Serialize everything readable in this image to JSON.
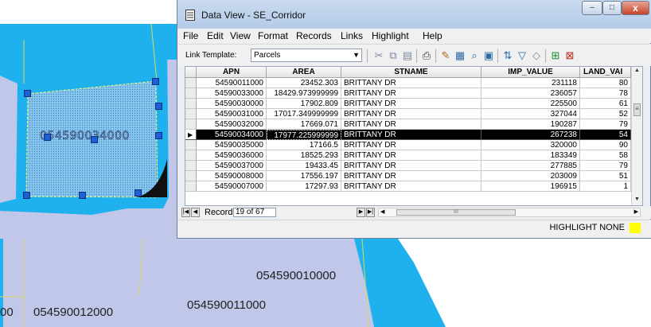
{
  "window": {
    "title": "Data View - SE_Corridor",
    "minimize": "–",
    "maximize": "□",
    "close": "x"
  },
  "menu": [
    "File",
    "Edit",
    "View",
    "Format",
    "Records",
    "Links",
    "Highlight",
    "Help"
  ],
  "toolbar": {
    "link_template_label": "Link Template:",
    "link_template_value": "Parcels",
    "icons": [
      "cut-icon",
      "copy-icon",
      "paste-icon",
      "print-icon",
      "edit-records-icon",
      "edit-fields-icon",
      "find-icon",
      "query-icon",
      "sort-icon",
      "filter-icon",
      "clear-filter-icon",
      "add-record-icon",
      "delete-record-icon"
    ]
  },
  "grid": {
    "columns": [
      "APN",
      "AREA",
      "STNAME",
      "IMP_VALUE",
      "LAND_VAI"
    ],
    "rows": [
      [
        "54590011000",
        "23452.303",
        "BRITTANY DR",
        "231118",
        "80"
      ],
      [
        "54590033000",
        "18429.973999999",
        "BRITTANY DR",
        "236057",
        "78"
      ],
      [
        "54590030000",
        "17902.809",
        "BRITTANY DR",
        "225500",
        "61"
      ],
      [
        "54590031000",
        "17017.349999999",
        "BRITTANY DR",
        "327044",
        "52"
      ],
      [
        "54590032000",
        "17669.071",
        "BRITTANY DR",
        "190287",
        "79"
      ],
      [
        "54590034000",
        "17977.225999999",
        "BRITTANY DR",
        "267238",
        "54"
      ],
      [
        "54590035000",
        "17166.5",
        "BRITTANY DR",
        "320000",
        "90"
      ],
      [
        "54590036000",
        "18525.293",
        "BRITTANY DR",
        "183349",
        "58"
      ],
      [
        "54590037000",
        "19433.45",
        "BRITTANY DR",
        "277885",
        "79"
      ],
      [
        "54590008000",
        "17556.197",
        "BRITTANY DR",
        "203009",
        "51"
      ],
      [
        "54590007000",
        "17297.93",
        "BRITTANY DR",
        "196915",
        "1"
      ]
    ],
    "selected_row": 5
  },
  "nav": {
    "record_label": "Record",
    "record_value": "19 of 67"
  },
  "status": {
    "highlight_text": "HIGHLIGHT  NONE",
    "highlight_color": "#ffff00"
  },
  "map": {
    "parcel_label": "054590034000",
    "labels": [
      "054590010000",
      "054590011000",
      "054590012000",
      "00"
    ]
  }
}
